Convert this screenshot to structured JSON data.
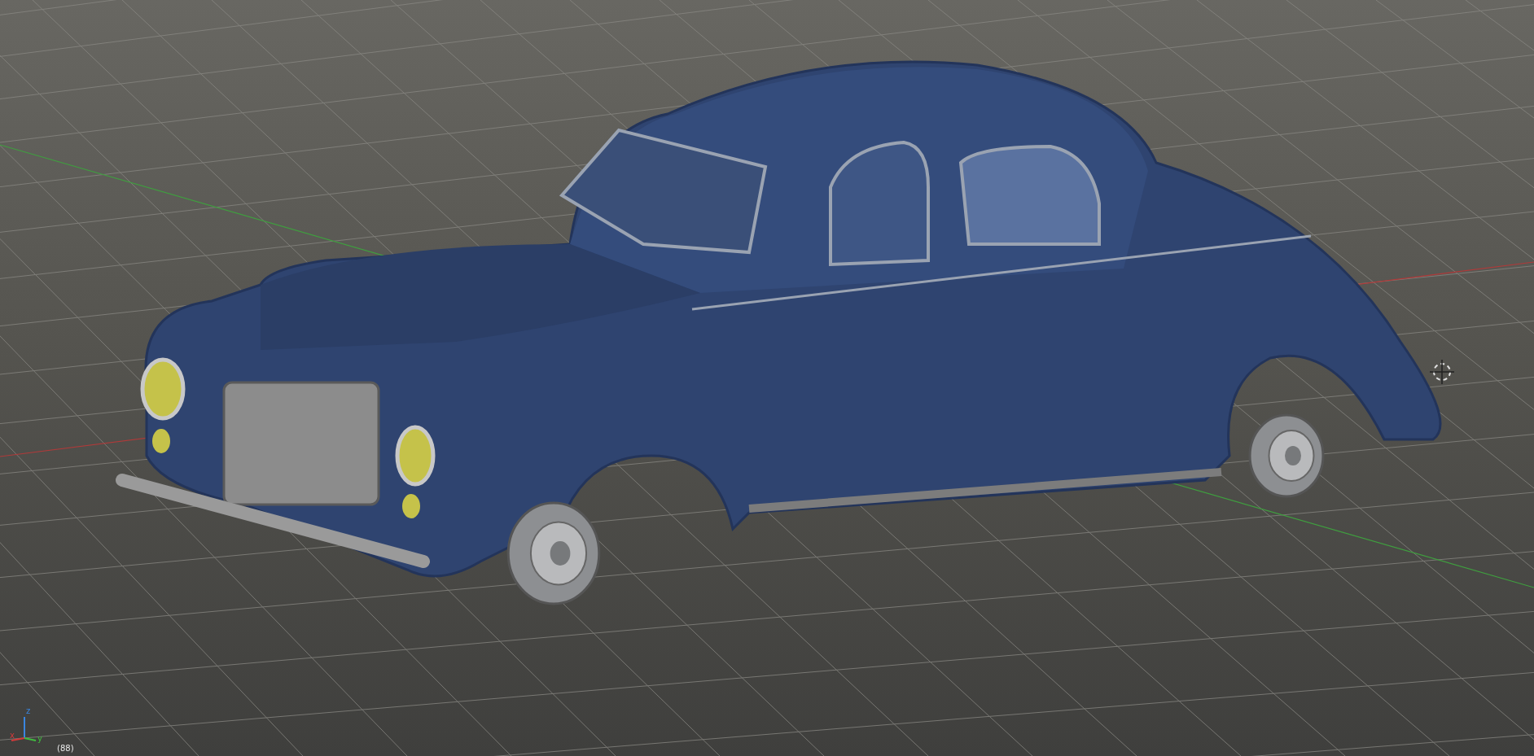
{
  "viewport": {
    "axis_labels": [
      "x",
      "y",
      "z"
    ],
    "frame_label": "(88)"
  }
}
